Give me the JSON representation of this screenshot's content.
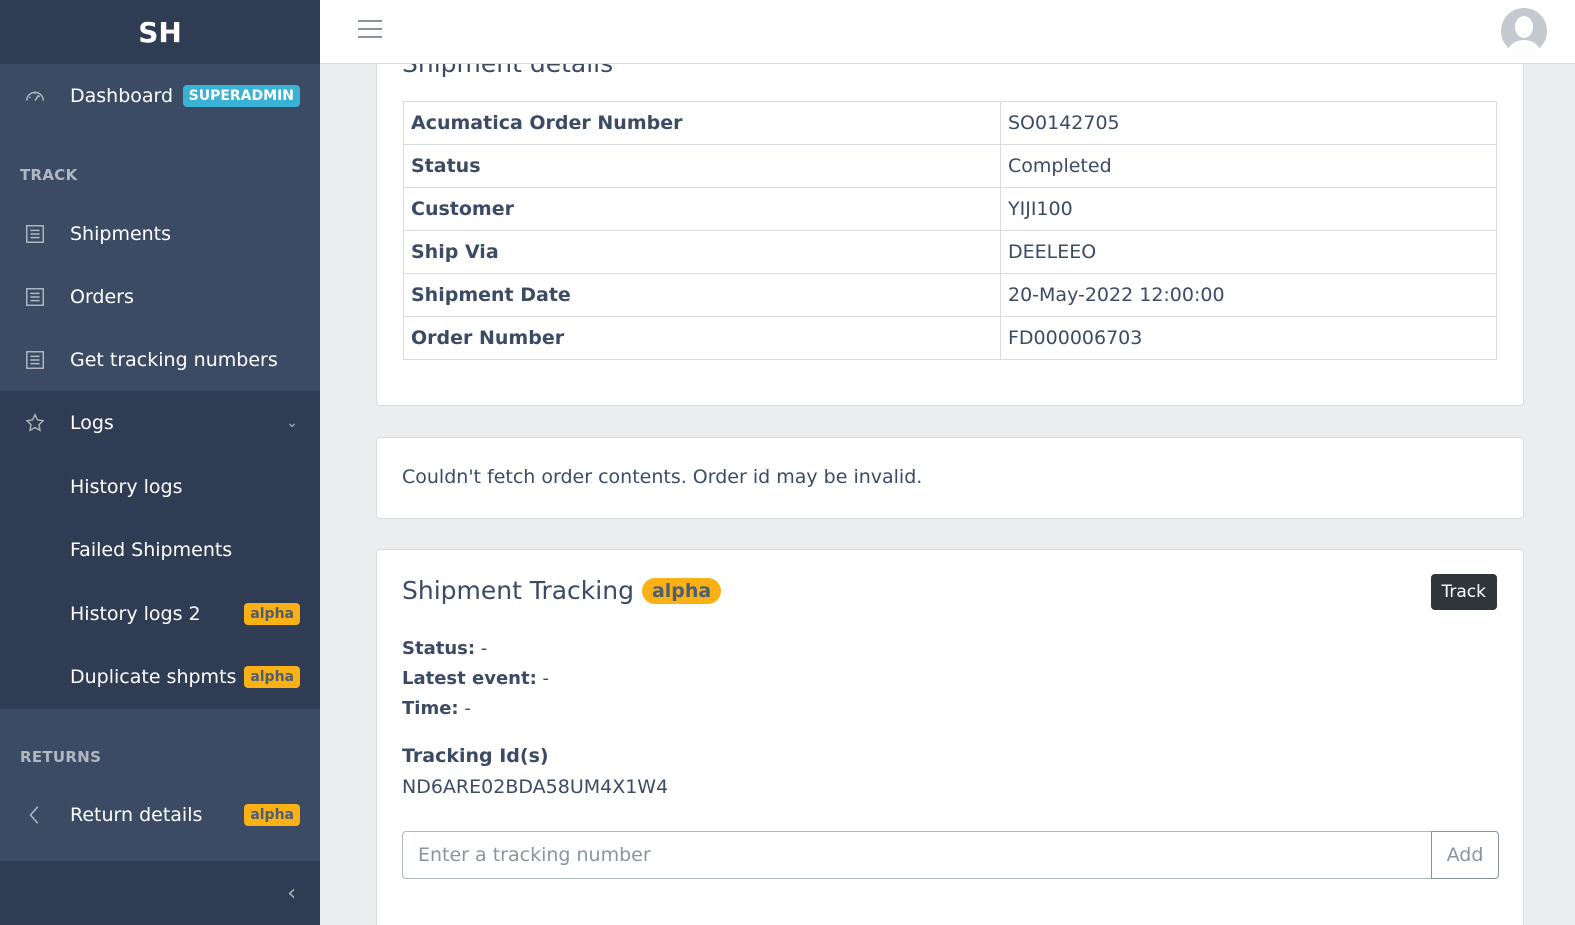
{
  "sidebar": {
    "brand": "SH",
    "dashboard_label": "Dashboard",
    "dashboard_badge": "SUPERADMIN",
    "section_track": "TRACK",
    "items": [
      {
        "label": "Shipments",
        "icon": "list-icon"
      },
      {
        "label": "Orders",
        "icon": "list-icon"
      },
      {
        "label": "Get tracking numbers",
        "icon": "list-icon"
      }
    ],
    "logs": {
      "label": "Logs",
      "children": [
        {
          "label": "History logs",
          "badge": ""
        },
        {
          "label": "Failed Shipments",
          "badge": ""
        },
        {
          "label": "History logs 2",
          "badge": "alpha"
        },
        {
          "label": "Duplicate shpmts",
          "badge": "alpha"
        }
      ]
    },
    "section_returns": "RETURNS",
    "return_details_label": "Return details",
    "return_details_badge": "alpha"
  },
  "shipment_details": {
    "title": "Shipment details",
    "rows": [
      {
        "key": "Acumatica Order Number",
        "value": "SO0142705"
      },
      {
        "key": "Status",
        "value": "Completed"
      },
      {
        "key": "Customer",
        "value": "YIJI100"
      },
      {
        "key": "Ship Via",
        "value": "DEELEEO"
      },
      {
        "key": "Shipment Date",
        "value": "20-May-2022 12:00:00"
      },
      {
        "key": "Order Number",
        "value": "FD000006703"
      }
    ]
  },
  "order_contents": {
    "message": "Couldn't fetch order contents. Order id may be invalid."
  },
  "tracking": {
    "title": "Shipment Tracking",
    "badge": "alpha",
    "track_button": "Track",
    "status_label": "Status:",
    "status_value": "-",
    "latest_event_label": "Latest event:",
    "latest_event_value": "-",
    "time_label": "Time:",
    "time_value": "-",
    "tracking_ids_label": "Tracking Id(s)",
    "tracking_ids_value": "ND6ARE02BDA58UM4X1W4",
    "input_placeholder": "Enter a tracking number",
    "add_button": "Add"
  },
  "colors": {
    "sidebar_bg": "#3c4b64",
    "sidebar_dark": "#303c54",
    "badge_info": "#39b2d5",
    "badge_warning": "#f9b115"
  }
}
